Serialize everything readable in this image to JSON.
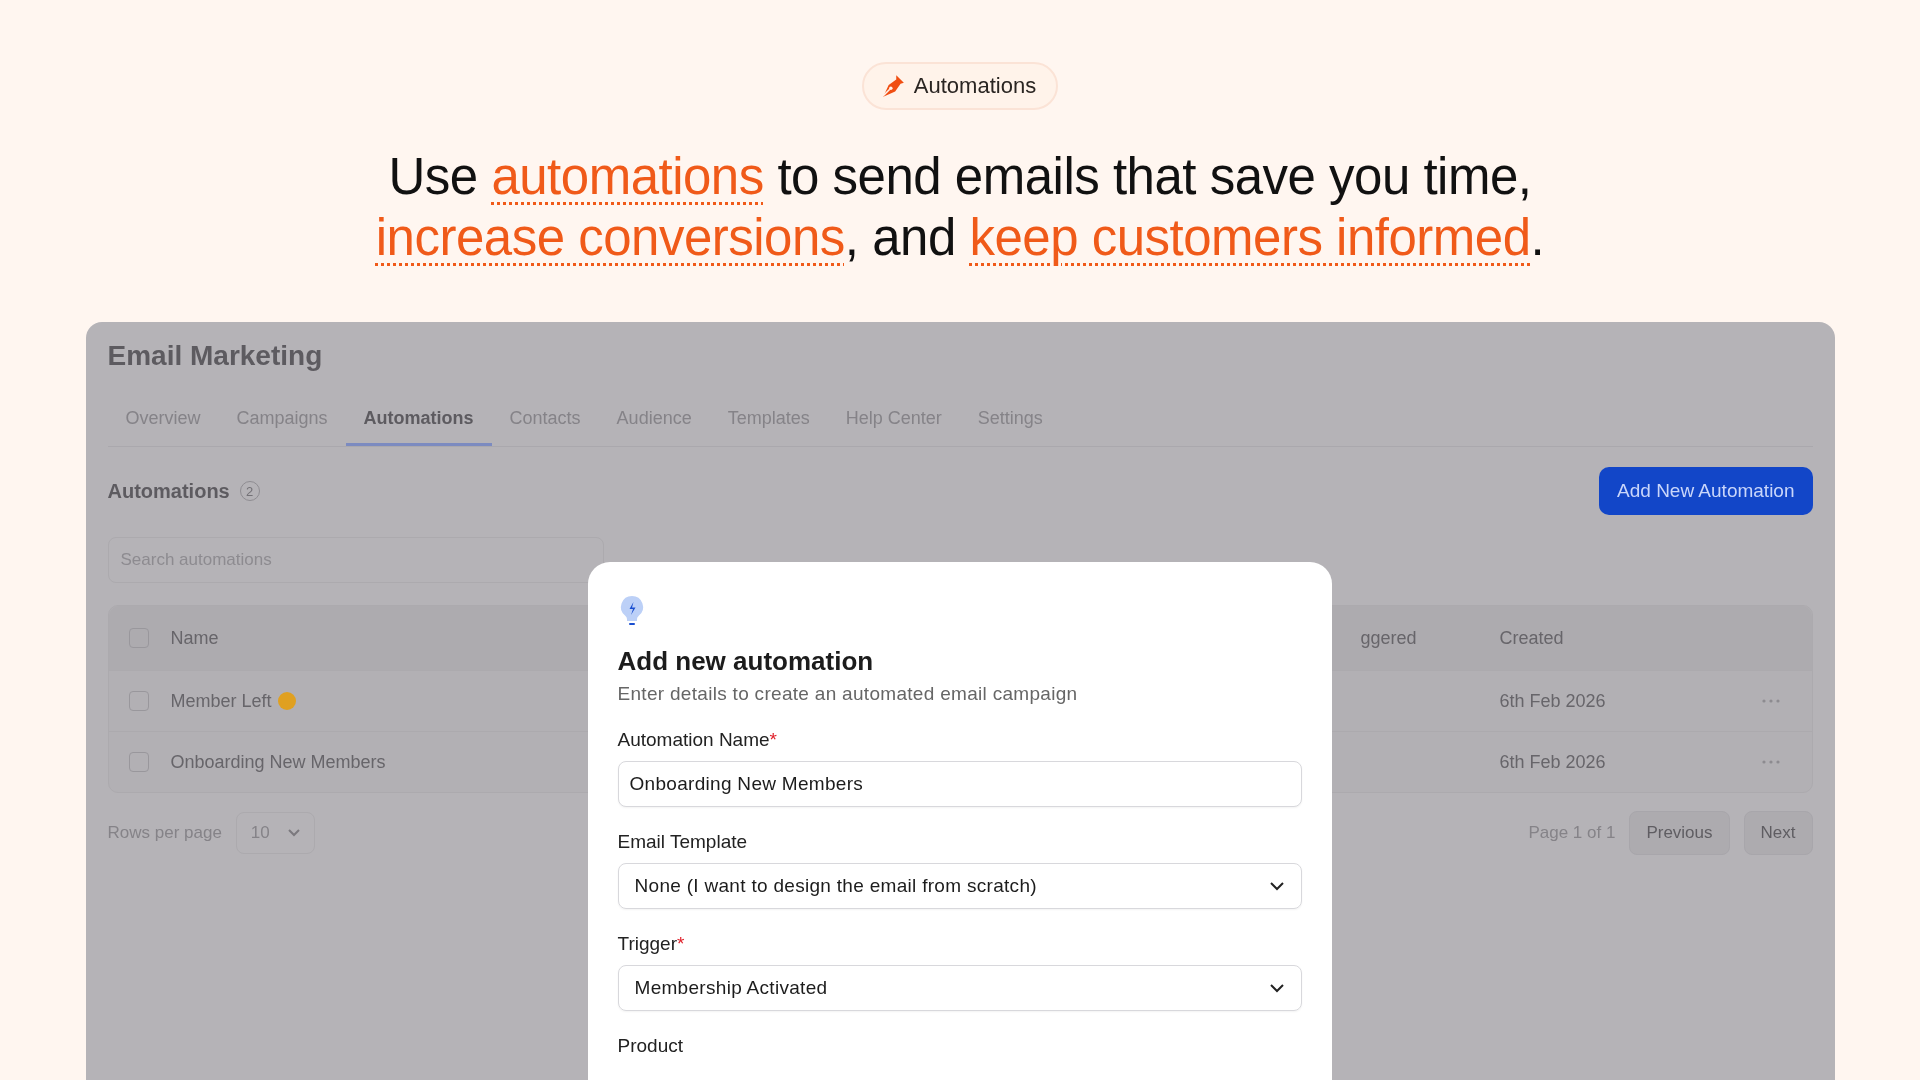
{
  "badge": {
    "label": "Automations"
  },
  "headline": [
    [
      {
        "text": "Use ",
        "highlight": false
      },
      {
        "text": "automations",
        "highlight": true
      },
      {
        "text": " to send emails that save you time,",
        "highlight": false
      }
    ],
    [
      {
        "text": "increase conversions",
        "highlight": true
      },
      {
        "text": ", and ",
        "highlight": false
      },
      {
        "text": "keep customers informed",
        "highlight": true
      },
      {
        "text": ".",
        "highlight": false
      }
    ]
  ],
  "app": {
    "title": "Email Marketing",
    "tabs": [
      {
        "label": "Overview",
        "selected": false
      },
      {
        "label": "Campaigns",
        "selected": false
      },
      {
        "label": "Automations",
        "selected": true
      },
      {
        "label": "Contacts",
        "selected": false
      },
      {
        "label": "Audience",
        "selected": false
      },
      {
        "label": "Templates",
        "selected": false
      },
      {
        "label": "Help Center",
        "selected": false
      },
      {
        "label": "Settings",
        "selected": false
      }
    ],
    "section_title": "Automations",
    "count": "2",
    "add_button": "Add New Automation",
    "search": {
      "placeholder": "Search automations"
    },
    "table": {
      "columns": [
        "Name",
        "ggered",
        "Created"
      ],
      "rows": [
        {
          "name": "Member Left",
          "emoji": true,
          "created": "6th Feb 2026",
          "checked": false
        },
        {
          "name": "Onboarding New Members",
          "created": "6th Feb 2026",
          "checked": false
        }
      ],
      "header_checked": false
    },
    "pagination": {
      "rows_label": "Rows per page",
      "rows_value": "10",
      "page": "Page 1 of 1",
      "previous": "Previous",
      "next": "Next"
    }
  },
  "modal": {
    "title": "Add new automation",
    "subtitle": "Enter details to create an automated email campaign",
    "fields": [
      {
        "kind": "input",
        "label": "Automation Name",
        "required_mark": "*",
        "value": "Onboarding New Members"
      },
      {
        "kind": "select",
        "label": "Email Template",
        "value": "None (I want to design the email from scratch)"
      },
      {
        "kind": "select",
        "label": "Trigger",
        "required_mark": "*",
        "value": "Membership Activated"
      },
      {
        "kind": "label",
        "label": "Product"
      }
    ]
  }
}
